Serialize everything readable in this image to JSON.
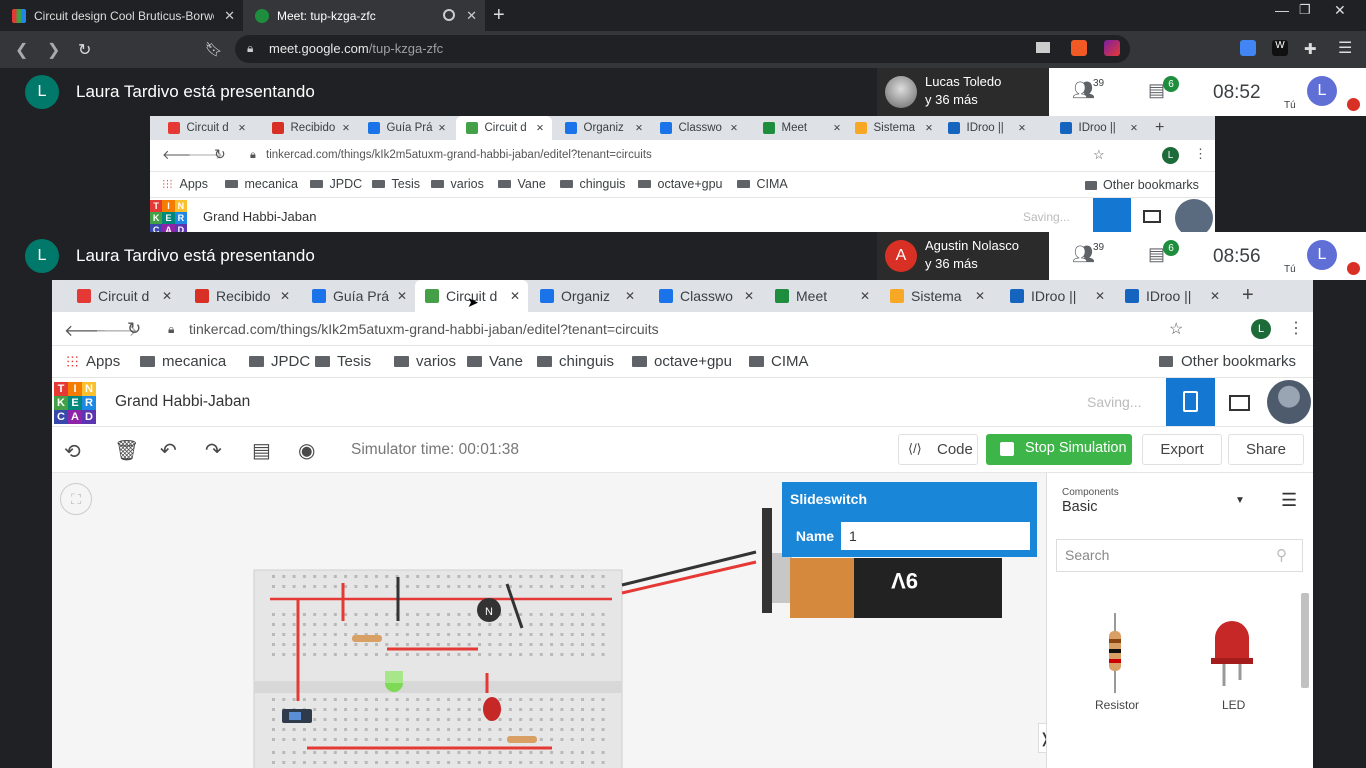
{
  "browser": {
    "tabs": [
      {
        "title": "Circuit design Cool Bruticus-Borwo | Tin",
        "active": false
      },
      {
        "title": "Meet: tup-kzga-zfc",
        "active": true
      }
    ],
    "url_domain": "meet.google.com",
    "url_path": "/tup-kzga-zfc"
  },
  "meet": {
    "panels": [
      {
        "presenter_avatar": "L",
        "presenter_text": "Laura Tardivo está presentando",
        "participant_name": "Lucas Toledo",
        "participant_more": "y 36 más",
        "people_count": "39",
        "chat_count": "6",
        "time": "08:52",
        "self_avatar": "L",
        "self_label": "Tú"
      },
      {
        "presenter_avatar": "L",
        "presenter_text": "Laura Tardivo está presentando",
        "participant_avatar": "A",
        "participant_name": "Agustin Nolasco",
        "participant_more": "y 36 más",
        "people_count": "39",
        "chat_count": "6",
        "time": "08:56",
        "self_avatar": "L",
        "self_label": "Tú"
      }
    ]
  },
  "shared": {
    "tabs": [
      "Circuit d",
      "Recibido",
      "Guía Prá",
      "Circuit d",
      "Organiz",
      "Classwo",
      "Meet",
      "Sistema",
      "IDroo ||",
      "IDroo ||"
    ],
    "url": "tinkercad.com/things/kIk2m5atuxm-grand-habbi-jaban/editel?tenant=circuits",
    "bookmarks": [
      "Apps",
      "mecanica",
      "JPDC",
      "Tesis",
      "varios",
      "Vane",
      "chinguis",
      "octave+gpu",
      "CIMA"
    ],
    "other_bookmarks": "Other bookmarks",
    "logo_letters": [
      "T",
      "I",
      "N",
      "K",
      "E",
      "R",
      "C",
      "A",
      "D"
    ],
    "project_title": "Grand Habbi-Jaban",
    "saving": "Saving...",
    "simulator_time": "Simulator time: 00:01:38",
    "code_label": "Code",
    "stop_label": "Stop Simulation",
    "export_label": "Export",
    "share_label": "Share",
    "popup_title": "Slideswitch",
    "popup_name_label": "Name",
    "popup_name_value": "1",
    "components_caption": "Components",
    "components_value": "Basic",
    "search_placeholder": "Search",
    "parts": [
      "Resistor",
      "LED"
    ],
    "transistor_letter": "N",
    "battery_label": "9V"
  },
  "colors": {
    "meet_green": "#1e8e3e",
    "avatar_teal": "#00796b",
    "avatar_red": "#d93025",
    "self_blue": "#5f6fd6",
    "tinkercad_blue": "#1477d1",
    "sim_green": "#3eb549"
  }
}
